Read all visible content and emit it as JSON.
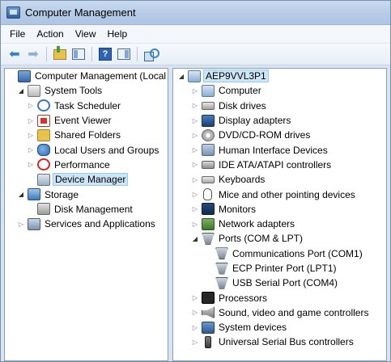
{
  "window": {
    "title": "Computer Management"
  },
  "menu": [
    "File",
    "Action",
    "View",
    "Help"
  ],
  "toolbar": {
    "icons": [
      "back-arrow-icon",
      "forward-arrow-icon",
      "up-folder-icon",
      "show-hide-console-tree-icon",
      "help-icon",
      "show-hide-action-pane-icon",
      "scan-hardware-icon"
    ]
  },
  "left_tree": [
    {
      "label": "Computer Management (Local",
      "level": 0,
      "expander": "",
      "icon": "computer-management-icon"
    },
    {
      "label": "System Tools",
      "level": 1,
      "expander": "open",
      "icon": "system-tools-icon"
    },
    {
      "label": "Task Scheduler",
      "level": 2,
      "expander": "closed",
      "icon": "task-scheduler-icon"
    },
    {
      "label": "Event Viewer",
      "level": 2,
      "expander": "closed",
      "icon": "event-viewer-icon"
    },
    {
      "label": "Shared Folders",
      "level": 2,
      "expander": "closed",
      "icon": "shared-folders-icon"
    },
    {
      "label": "Local Users and Groups",
      "level": 2,
      "expander": "closed",
      "icon": "local-users-icon"
    },
    {
      "label": "Performance",
      "level": 2,
      "expander": "closed",
      "icon": "performance-icon"
    },
    {
      "label": "Device Manager",
      "level": 2,
      "expander": "",
      "icon": "device-manager-icon",
      "selected": true
    },
    {
      "label": "Storage",
      "level": 1,
      "expander": "open",
      "icon": "storage-icon"
    },
    {
      "label": "Disk Management",
      "level": 2,
      "expander": "",
      "icon": "disk-management-icon"
    },
    {
      "label": "Services and Applications",
      "level": 1,
      "expander": "closed",
      "icon": "services-applications-icon"
    }
  ],
  "right_tree": [
    {
      "label": "AEP9VVL3P1",
      "level": 0,
      "expander": "open",
      "icon": "computer-icon",
      "selected": true
    },
    {
      "label": "Computer",
      "level": 1,
      "expander": "closed",
      "icon": "computer-icon"
    },
    {
      "label": "Disk drives",
      "level": 1,
      "expander": "closed",
      "icon": "disk-drive-icon"
    },
    {
      "label": "Display adapters",
      "level": 1,
      "expander": "closed",
      "icon": "display-adapter-icon"
    },
    {
      "label": "DVD/CD-ROM drives",
      "level": 1,
      "expander": "closed",
      "icon": "dvd-icon"
    },
    {
      "label": "Human Interface Devices",
      "level": 1,
      "expander": "closed",
      "icon": "hid-icon"
    },
    {
      "label": "IDE ATA/ATAPI controllers",
      "level": 1,
      "expander": "closed",
      "icon": "ide-controller-icon"
    },
    {
      "label": "Keyboards",
      "level": 1,
      "expander": "closed",
      "icon": "keyboard-icon"
    },
    {
      "label": "Mice and other pointing devices",
      "level": 1,
      "expander": "closed",
      "icon": "mouse-icon"
    },
    {
      "label": "Monitors",
      "level": 1,
      "expander": "closed",
      "icon": "monitor-icon"
    },
    {
      "label": "Network adapters",
      "level": 1,
      "expander": "closed",
      "icon": "network-adapter-icon"
    },
    {
      "label": "Ports (COM & LPT)",
      "level": 1,
      "expander": "open",
      "icon": "port-icon"
    },
    {
      "label": "Communications Port (COM1)",
      "level": 2,
      "expander": "",
      "icon": "port-icon"
    },
    {
      "label": "ECP Printer Port (LPT1)",
      "level": 2,
      "expander": "",
      "icon": "port-icon"
    },
    {
      "label": "USB Serial Port (COM4)",
      "level": 2,
      "expander": "",
      "icon": "port-icon",
      "highlighted": true
    },
    {
      "label": "Processors",
      "level": 1,
      "expander": "closed",
      "icon": "processor-icon"
    },
    {
      "label": "Sound, video and game controllers",
      "level": 1,
      "expander": "closed",
      "icon": "sound-icon"
    },
    {
      "label": "System devices",
      "level": 1,
      "expander": "closed",
      "icon": "system-devices-icon"
    },
    {
      "label": "Universal Serial Bus controllers",
      "level": 1,
      "expander": "closed",
      "icon": "usb-icon"
    }
  ],
  "colors": {
    "selection_fill": "#cde6f7",
    "highlight_underline": "#e01010",
    "titlebar": "#b6cbe6"
  }
}
